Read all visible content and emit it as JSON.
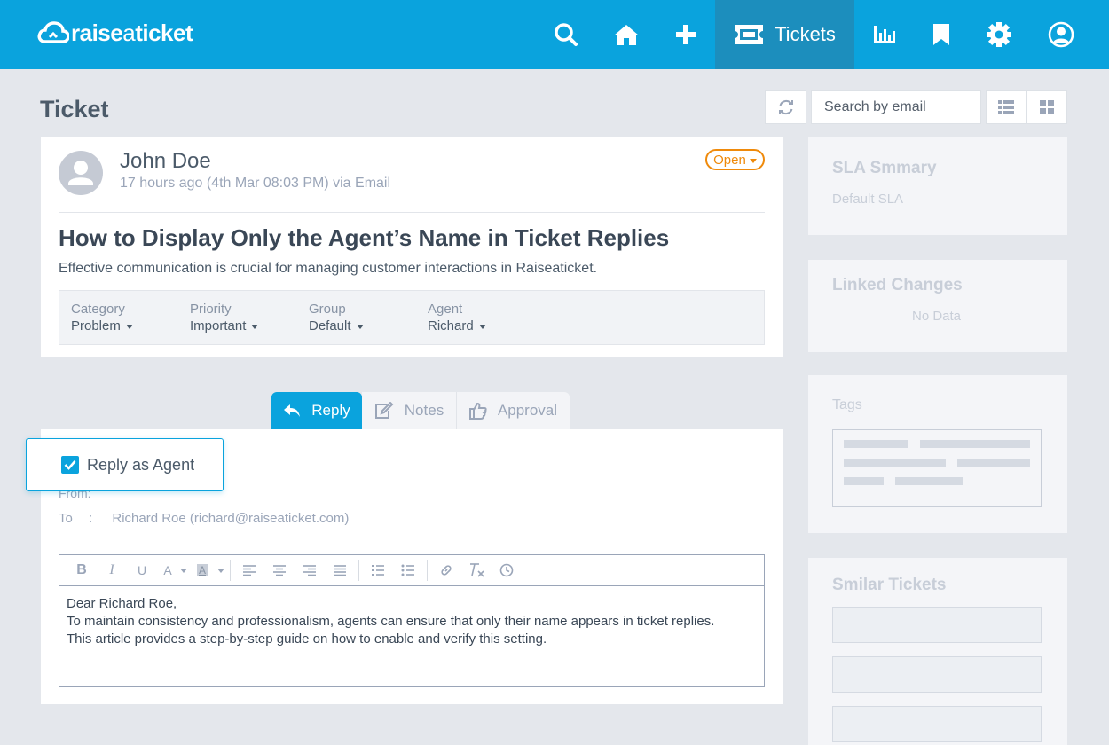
{
  "brand": {
    "logo_text_a": "raise",
    "logo_text_b": "a",
    "logo_text_c": "ticket"
  },
  "nav": {
    "active_label": "Tickets",
    "icons": [
      "search-icon",
      "home-icon",
      "plus-icon",
      "ticket-icon",
      "bar-chart-icon",
      "bookmark-icon",
      "gear-icon",
      "user-circle-icon"
    ]
  },
  "page": {
    "title": "Ticket"
  },
  "toolbar": {
    "search_placeholder": "Search by email"
  },
  "ticket": {
    "author": "John Doe",
    "meta": "17 hours ago (4th Mar 08:03 PM) via Email",
    "status": "Open",
    "subject": "How to Display Only the Agent’s Name in Ticket Replies",
    "description": "Effective communication is crucial for managing customer interactions in Raiseaticket.",
    "properties": [
      {
        "label": "Category",
        "value": "Problem"
      },
      {
        "label": "Priority",
        "value": "Important"
      },
      {
        "label": "Group",
        "value": "Default"
      },
      {
        "label": "Agent",
        "value": "Richard"
      }
    ]
  },
  "reply": {
    "tabs": {
      "reply": "Reply",
      "notes": "Notes",
      "approval": "Approval"
    },
    "reply_as_agent": "Reply as Agent",
    "from_label": "From:",
    "to_label": "To",
    "to_sep": ":",
    "to_value": "Richard Roe (richard@raiseaticket.com)",
    "body_lines": [
      "Dear Richard Roe,",
      "To maintain consistency and professionalism, agents can ensure that only their name appears in ticket replies.",
      "This article provides a step-by-step guide on how to enable and verify this setting."
    ],
    "editor_tools": {
      "bold": "B",
      "italic": "I",
      "underline": "U",
      "font_color": "A",
      "bg_color": "A"
    }
  },
  "side": {
    "sla_title": "SLA Smmary",
    "sla_value": "Default SLA",
    "linked_title": "Linked Changes",
    "linked_empty": "No Data",
    "tags_title": "Tags",
    "similar_title": "Smilar Tickets"
  },
  "colors": {
    "primary": "#0aa3dd",
    "nav_active": "#1c8ebd",
    "status_open": "#ef8a0b",
    "page_bg": "#e4e7ec"
  }
}
